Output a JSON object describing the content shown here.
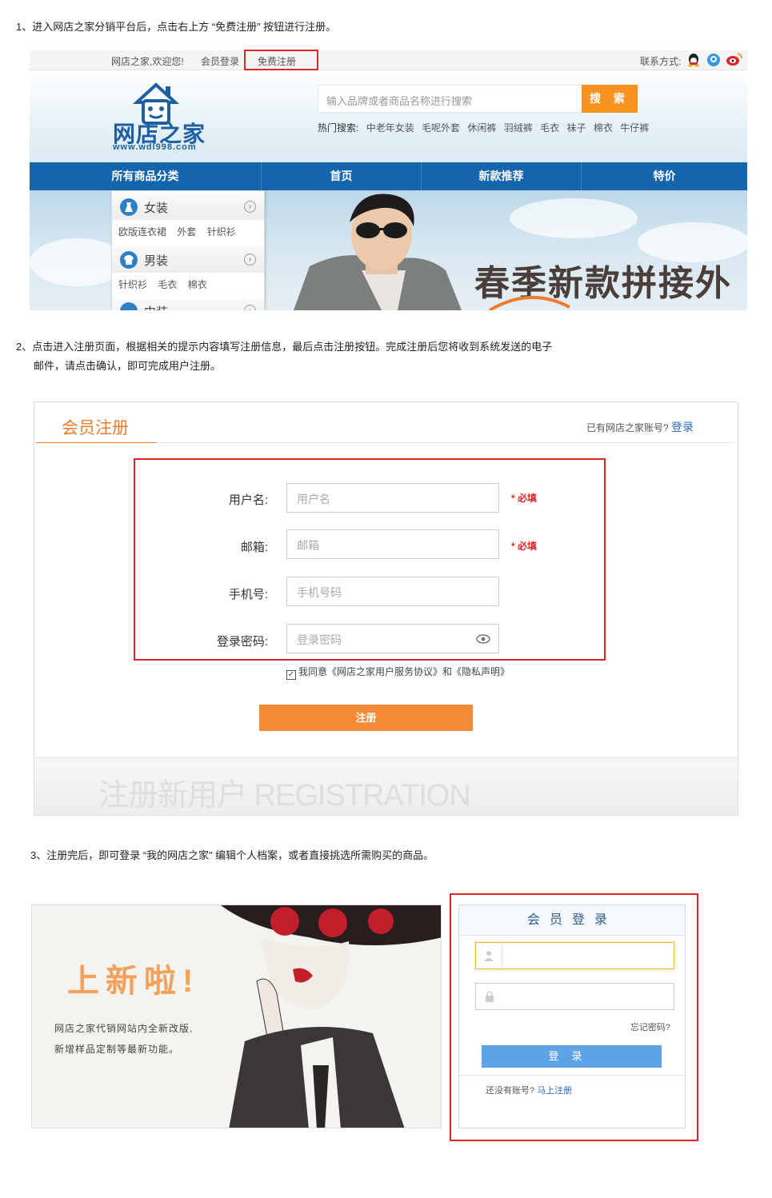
{
  "steps": {
    "step1": "1、进入网店之家分销平台后，点击右上方 “免费注册” 按钮进行注册。",
    "step2_line1": "2、点击进入注册页面，根据相关的提示内容填写注册信息，最后点击注册按钮。完成注册后您将收到系统发送的电子",
    "step2_line2": "邮件，请点击确认，即可完成用户注册。",
    "step3": "3、注册完后，即可登录 “我的网店之家” 编辑个人档案，或者直接挑选所需购买的商品。"
  },
  "topbar": {
    "welcome": "网店之家,欢迎您!",
    "login": "会员登录",
    "register": "免费注册",
    "contact": "联系方式:"
  },
  "header": {
    "logo_text": "网店之家",
    "logo_url": "www.wdl998.com",
    "search_placeholder": "输入品牌或者商品名称进行搜索",
    "search_button": "搜 索",
    "hot_label": "热门搜索:",
    "hot_words": [
      "中老年女装",
      "毛呢外套",
      "休闲裤",
      "羽绒裤",
      "毛衣",
      "袜子",
      "棉衣",
      "牛仔裤"
    ]
  },
  "nav": {
    "items": [
      "所有商品分类",
      "首页",
      "新款推荐",
      "特价"
    ]
  },
  "categories": [
    {
      "name": "女装",
      "subs": [
        "欧版连衣裙",
        "外套",
        "针织衫"
      ]
    },
    {
      "name": "男装",
      "subs": [
        "针织衫",
        "毛衣",
        "棉衣"
      ]
    },
    {
      "name": "中装",
      "subs": []
    }
  ],
  "banner": {
    "headline": "春季新款拼接外"
  },
  "register": {
    "title": "会员注册",
    "have_account": "已有网店之家账号?",
    "login_link": "登录",
    "fields": [
      {
        "label": "用户名:",
        "placeholder": "用户名",
        "required": "* 必填"
      },
      {
        "label": "邮箱:",
        "placeholder": "邮箱",
        "required": "* 必填"
      },
      {
        "label": "手机号:",
        "placeholder": "手机号码",
        "required": ""
      },
      {
        "label": "登录密码:",
        "placeholder": "登录密码",
        "required": ""
      }
    ],
    "agree_text": "我同意《网店之家用户服务协议》和《隐私声明》",
    "submit": "注册",
    "footer_watermark": "注册新用户 REGISTRATION"
  },
  "promo": {
    "headline": "上新啦!",
    "desc_line1": "网店之家代销网站内全新改版,",
    "desc_line2": "新增样品定制等最新功能。"
  },
  "login": {
    "title": "会员登录",
    "forgot": "忘记密码?",
    "button": "登录",
    "no_account": "还没有账号?",
    "register_link": "马上注册"
  },
  "colors": {
    "accent_orange": "#f58a35",
    "nav_blue": "#1565ad",
    "highlight_red": "#e0252a",
    "login_blue": "#5ea3e6"
  }
}
